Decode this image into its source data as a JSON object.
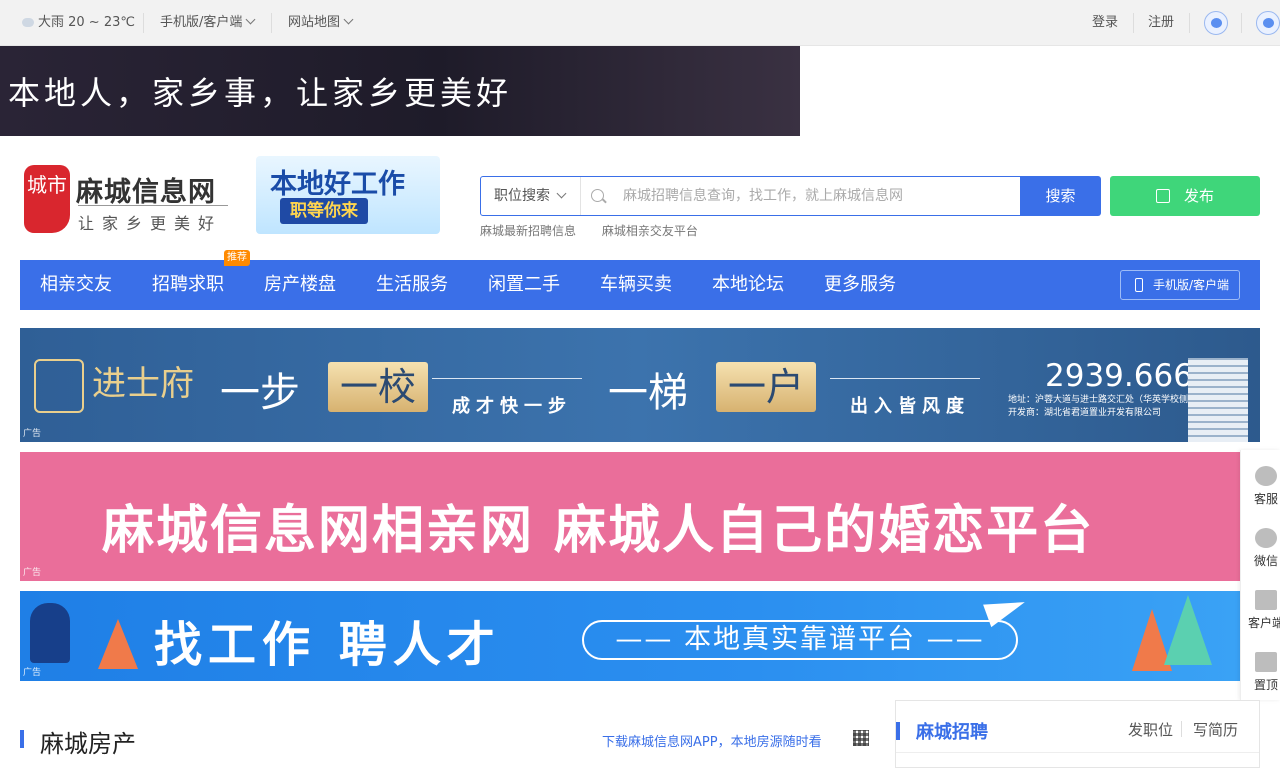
{
  "topbar": {
    "weather": "大雨 20 ~ 23℃",
    "mobile_app": "手机版/客户端",
    "sitemap": "网站地图",
    "login": "登录",
    "register": "注册"
  },
  "top_banner": {
    "text": "本地人，家乡事，让家乡更美好"
  },
  "logo": {
    "mark": "城市",
    "name": "麻城信息网",
    "slogan": "让家乡更美好"
  },
  "job_badge": {
    "line1": "本地好工作",
    "line2": "职等你来"
  },
  "search": {
    "type_label": "职位搜索",
    "placeholder": "麻城招聘信息查询，找工作，就上麻城信息网",
    "button": "搜索"
  },
  "publish_label": "发布",
  "quick_links": [
    "麻城最新招聘信息",
    "麻城相亲交友平台"
  ],
  "nav": {
    "items": [
      "相亲交友",
      "招聘求职",
      "房产楼盘",
      "生活服务",
      "闲置二手",
      "车辆买卖",
      "本地论坛",
      "更多服务"
    ],
    "hot_badge": "推荐",
    "mobile_button": "手机版/客户端"
  },
  "ads": {
    "tag": "广告",
    "estate": {
      "brand": "进士府",
      "w1": "一步",
      "gold1": "一校",
      "sub1": "成才快一步",
      "w2": "一梯",
      "gold2": "一户",
      "sub2": "出入皆风度",
      "phone": "2939.666",
      "address": "地址：沪蓉大道与进士路交汇处（华英学校侧门旁）",
      "developer": "开发商：湖北省君道置业开发有限公司"
    },
    "dating": {
      "text": "麻城信息网相亲网  麻城人自己的婚恋平台"
    },
    "jobs": {
      "big": "找工作  聘人才",
      "pill": "—— 本地真实靠谱平台 ——"
    }
  },
  "side_tools": [
    "客服",
    "微信",
    "客户端",
    "置顶"
  ],
  "realestate_section": {
    "title": "麻城房产",
    "link": "下载麻城信息网APP，本地房源随时看"
  },
  "recruit_panel": {
    "title": "麻城招聘",
    "post_job": "发职位",
    "write_resume": "写简历"
  },
  "colors": {
    "primary": "#3a6fe8",
    "publish": "#3fd67a",
    "brand_red": "#d9262e",
    "dating_pink": "#ea6e9a"
  }
}
